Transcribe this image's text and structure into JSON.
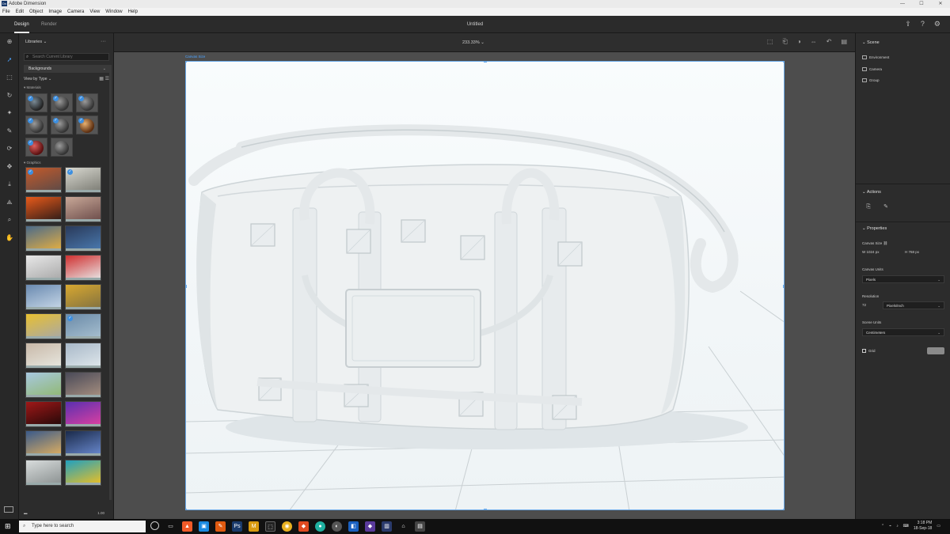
{
  "window": {
    "title": "Adobe Dimension",
    "app_icon": "Dn",
    "controls": [
      "—",
      "☐",
      "✕"
    ]
  },
  "menu": [
    "File",
    "Edit",
    "Object",
    "Image",
    "Camera",
    "View",
    "Window",
    "Help"
  ],
  "topbar": {
    "tabs": [
      "Design",
      "Render"
    ],
    "active_tab": "Design",
    "document_title": "Untitled"
  },
  "assets_panel": {
    "library": "Libraries",
    "search_placeholder": "Search Current Library",
    "category": "Backgrounds",
    "filter": "View by Type",
    "sections": {
      "materials": "Materials",
      "lights": "Graphics"
    },
    "materials": [
      {
        "style": "dark",
        "checked": true
      },
      {
        "style": "plain",
        "checked": true
      },
      {
        "style": "plain",
        "checked": true
      },
      {
        "style": "plain",
        "checked": true
      },
      {
        "style": "plain",
        "checked": true
      },
      {
        "style": "copper",
        "checked": true
      },
      {
        "style": "red",
        "checked": true
      },
      {
        "style": "plain",
        "checked": false
      }
    ],
    "lights": [
      {
        "colors": [
          "#c45a2a",
          "#5a4a48"
        ],
        "checked": true
      },
      {
        "colors": [
          "#d8d8d0",
          "#7a7a72"
        ],
        "checked": true
      },
      {
        "colors": [
          "#e85a1a",
          "#2a1a18"
        ],
        "checked": false
      },
      {
        "colors": [
          "#c8a898",
          "#6a4a48"
        ],
        "checked": false
      },
      {
        "colors": [
          "#4a6a8a",
          "#e8b040"
        ],
        "checked": false
      },
      {
        "colors": [
          "#2a3a5a",
          "#4a7ab0"
        ],
        "checked": false
      },
      {
        "colors": [
          "#e8e8e8",
          "#a8a8a8"
        ],
        "checked": false
      },
      {
        "colors": [
          "#d03030",
          "#e8e8e8"
        ],
        "checked": false
      },
      {
        "colors": [
          "#6a8ab0",
          "#c8d8e8"
        ],
        "checked": false
      },
      {
        "colors": [
          "#d8a830",
          "#807040"
        ],
        "checked": false
      },
      {
        "colors": [
          "#e8c030",
          "#a8a8a8"
        ],
        "checked": false
      },
      {
        "colors": [
          "#6a8aa8",
          "#a8c0d0"
        ],
        "checked": true
      },
      {
        "colors": [
          "#c8b8a8",
          "#e8e8e0"
        ],
        "checked": false
      },
      {
        "colors": [
          "#a8b8c8",
          "#e0e8ec"
        ],
        "checked": false
      },
      {
        "colors": [
          "#a8c8e0",
          "#90b870"
        ],
        "checked": false
      },
      {
        "colors": [
          "#4a4a58",
          "#a89080"
        ],
        "checked": false
      },
      {
        "colors": [
          "#a01818",
          "#200808"
        ],
        "checked": false
      },
      {
        "colors": [
          "#5a30b0",
          "#e040a0"
        ],
        "checked": false
      },
      {
        "colors": [
          "#3a5a8a",
          "#e0b060"
        ],
        "checked": false
      },
      {
        "colors": [
          "#1a2a4a",
          "#6a8ad0"
        ],
        "checked": false
      },
      {
        "colors": [
          "#d8dcdc",
          "#8a9090"
        ],
        "checked": false
      },
      {
        "colors": [
          "#20a0c0",
          "#f0c020"
        ],
        "checked": false
      }
    ],
    "footer_value": "1.00"
  },
  "canvas": {
    "zoom": "233.33%",
    "frame_label": "Canvas Size"
  },
  "properties_panel": {
    "scene_header": "Scene",
    "scene_items": [
      "Environment",
      "Camera",
      "Group"
    ],
    "actions_header": "Actions",
    "properties_header": "Properties",
    "canvas_size_label": "Canvas Size",
    "width_label": "W",
    "width_value": "1024 px",
    "height_label": "H",
    "height_value": "768 px",
    "canvas_units_label": "Canvas Units",
    "canvas_units_value": "Pixels",
    "resolution_label": "Resolution",
    "resolution_value": "72",
    "resolution_unit": "Pixels/Inch",
    "scene_units_label": "Scene Units",
    "scene_units_value": "Centimeters",
    "grid_label": "Grid"
  },
  "taskbar": {
    "search_placeholder": "Type here to search",
    "time": "3:18 PM",
    "date": "18-Sep-18"
  }
}
